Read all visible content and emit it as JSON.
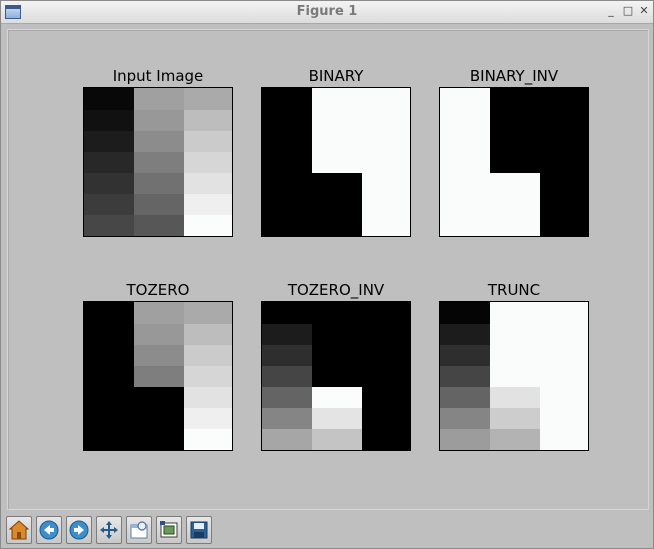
{
  "window": {
    "title": "Figure 1"
  },
  "subplots": [
    {
      "title": "Input Image"
    },
    {
      "title": "BINARY"
    },
    {
      "title": "BINARY_INV"
    },
    {
      "title": "TOZERO"
    },
    {
      "title": "TOZERO_INV"
    },
    {
      "title": "TRUNC"
    }
  ],
  "toolbar": {
    "buttons": [
      {
        "name": "home",
        "icon": "home-icon"
      },
      {
        "name": "back",
        "icon": "arrow-left-icon"
      },
      {
        "name": "forward",
        "icon": "arrow-right-icon"
      },
      {
        "name": "pan",
        "icon": "move-icon"
      },
      {
        "name": "zoom",
        "icon": "zoom-icon"
      },
      {
        "name": "configure-subplots",
        "icon": "subplots-icon"
      },
      {
        "name": "save",
        "icon": "save-icon"
      }
    ]
  }
}
